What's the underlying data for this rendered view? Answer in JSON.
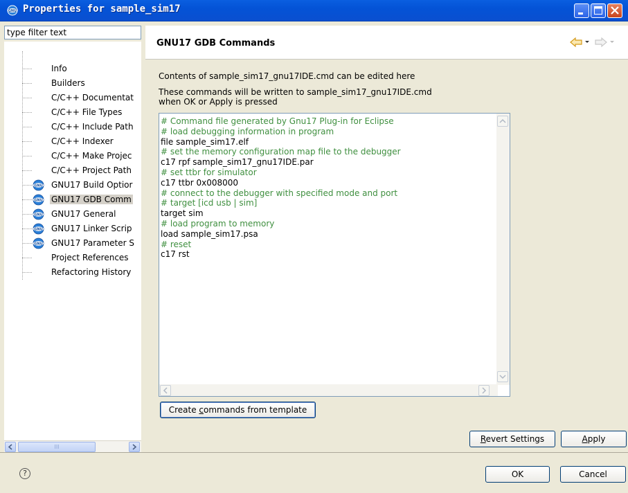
{
  "window": {
    "title": "Properties for sample_sim17"
  },
  "filter": {
    "placeholder": "type filter text"
  },
  "tree": [
    {
      "label": "Info",
      "icon": "",
      "selected": false
    },
    {
      "label": "Builders",
      "icon": "",
      "selected": false
    },
    {
      "label": "C/C++ Documentat",
      "icon": "",
      "selected": false
    },
    {
      "label": "C/C++ File Types",
      "icon": "",
      "selected": false
    },
    {
      "label": "C/C++ Include Path",
      "icon": "",
      "selected": false
    },
    {
      "label": "C/C++ Indexer",
      "icon": "",
      "selected": false
    },
    {
      "label": "C/C++ Make Projec",
      "icon": "",
      "selected": false
    },
    {
      "label": "C/C++ Project Path",
      "icon": "",
      "selected": false
    },
    {
      "label": "GNU17 Build Optior",
      "icon": "gnu-icon",
      "selected": false
    },
    {
      "label": "GNU17 GDB Comm",
      "icon": "gnu-icon",
      "selected": true
    },
    {
      "label": "GNU17 General",
      "icon": "gnu-icon",
      "selected": false
    },
    {
      "label": "GNU17 Linker Scrip",
      "icon": "gnu-icon",
      "selected": false
    },
    {
      "label": "GNU17 Parameter S",
      "icon": "gnu-icon",
      "selected": false
    },
    {
      "label": "Project References",
      "icon": "",
      "selected": false
    },
    {
      "label": "Refactoring History",
      "icon": "",
      "selected": false
    }
  ],
  "scrollbar": {
    "thumb_glyph": "III"
  },
  "page": {
    "title": "GNU17 GDB Commands",
    "desc_line1": "Contents of sample_sim17_gnu17IDE.cmd can be edited here",
    "desc_line2": "These commands will be written to  sample_sim17_gnu17IDE.cmd",
    "desc_line3": "when OK or Apply is pressed"
  },
  "editor": {
    "lines": [
      {
        "text": "# Command file generated by Gnu17 Plug-in for Eclipse",
        "comment": true
      },
      {
        "text": "# load debugging information in program",
        "comment": true
      },
      {
        "text": "file sample_sim17.elf",
        "comment": false
      },
      {
        "text": "# set the memory configuration map file to the debugger",
        "comment": true
      },
      {
        "text": "c17 rpf sample_sim17_gnu17IDE.par",
        "comment": false
      },
      {
        "text": "# set ttbr for simulator",
        "comment": true
      },
      {
        "text": "c17 ttbr 0x008000",
        "comment": false
      },
      {
        "text": "# connect to the debugger with specified mode and port",
        "comment": true
      },
      {
        "text": "# target [icd usb | sim]",
        "comment": true
      },
      {
        "text": "target sim",
        "comment": false
      },
      {
        "text": "# load program to memory",
        "comment": true
      },
      {
        "text": "load sample_sim17.psa",
        "comment": false
      },
      {
        "text": "# reset",
        "comment": true
      },
      {
        "text": "c17 rst",
        "comment": false
      }
    ]
  },
  "buttons": {
    "create_template": "Create commands from template",
    "revert": "Revert Settings",
    "apply": "Apply",
    "ok": "OK",
    "cancel": "Cancel"
  },
  "help": {
    "glyph": "?"
  },
  "colors": {
    "comment": "#3f8f3f",
    "titlebar": "#0453d6",
    "nav_arrow": "#e0a020"
  }
}
